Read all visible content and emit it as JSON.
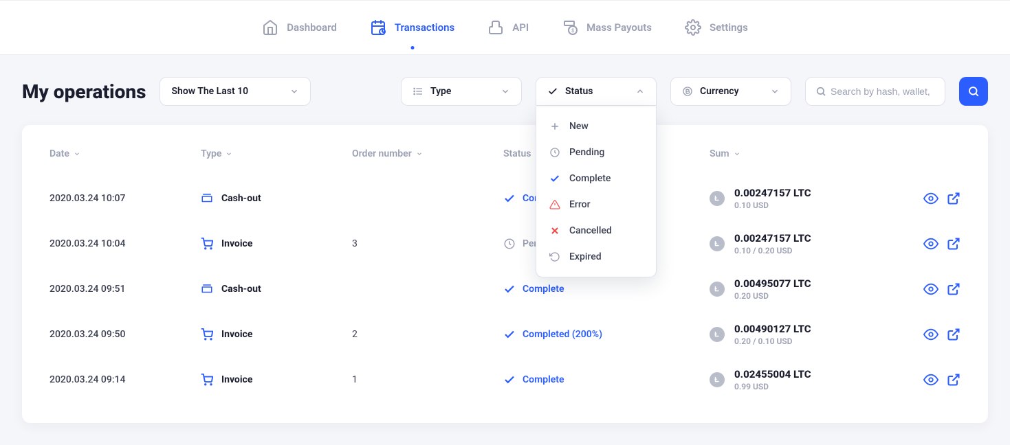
{
  "nav": {
    "dashboard": "Dashboard",
    "transactions": "Transactions",
    "api": "API",
    "mass_payouts": "Mass Payouts",
    "settings": "Settings"
  },
  "page_title": "My operations",
  "filters": {
    "show_last": "Show The Last 10",
    "type": "Type",
    "status": "Status",
    "currency": "Currency",
    "search_placeholder": "Search by hash, wallet,"
  },
  "status_options": [
    {
      "key": "new",
      "label": "New"
    },
    {
      "key": "pending",
      "label": "Pending"
    },
    {
      "key": "complete",
      "label": "Complete"
    },
    {
      "key": "error",
      "label": "Error"
    },
    {
      "key": "cancelled",
      "label": "Cancelled"
    },
    {
      "key": "expired",
      "label": "Expired"
    }
  ],
  "columns": {
    "date": "Date",
    "type": "Type",
    "order": "Order number",
    "status": "Status",
    "sum": "Sum"
  },
  "rows": [
    {
      "date": "2020.03.24 10:07",
      "type": "Cash-out",
      "type_kind": "cash-out",
      "order": "",
      "status": "Complete",
      "status_kind": "complete",
      "coin": "LTC",
      "crypto": "0.00247157 LTC",
      "fiat": "0.10 USD"
    },
    {
      "date": "2020.03.24 10:04",
      "type": "Invoice",
      "type_kind": "invoice",
      "order": "3",
      "status": "Pending",
      "status_kind": "pending",
      "coin": "LTC",
      "crypto": "0.00247157 LTC",
      "fiat": "0.10 / 0.20 USD"
    },
    {
      "date": "2020.03.24 09:51",
      "type": "Cash-out",
      "type_kind": "cash-out",
      "order": "",
      "status": "Complete",
      "status_kind": "complete",
      "coin": "LTC",
      "crypto": "0.00495077 LTC",
      "fiat": "0.20 USD"
    },
    {
      "date": "2020.03.24 09:50",
      "type": "Invoice",
      "type_kind": "invoice",
      "order": "2",
      "status": "Completed (200%)",
      "status_kind": "complete",
      "coin": "LTC",
      "crypto": "0.00490127 LTC",
      "fiat": "0.20 / 0.10 USD"
    },
    {
      "date": "2020.03.24 09:14",
      "type": "Invoice",
      "type_kind": "invoice",
      "order": "1",
      "status": "Complete",
      "status_kind": "complete",
      "coin": "LTC",
      "crypto": "0.02455004 LTC",
      "fiat": "0.99 USD"
    }
  ]
}
